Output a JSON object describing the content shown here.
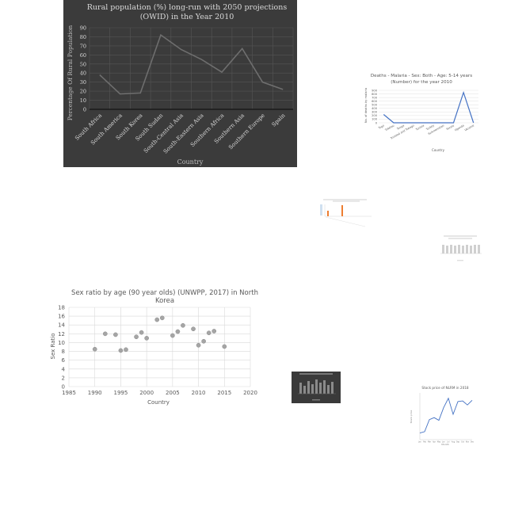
{
  "chart_data": [
    {
      "type": "line",
      "title": "Rural population (%) long-run with 2050 projections (OWID) in the Year 2010",
      "xlabel": "Country",
      "ylabel": "Percentage Of Rural Population",
      "categories": [
        "South Africa",
        "South America",
        "South Korea",
        "South Sudan",
        "South-Central Asia",
        "South-Eastern Asia",
        "Southern Africa",
        "Southern Asia",
        "Southern Europe",
        "Spain"
      ],
      "values": [
        38,
        17,
        18,
        82,
        66,
        55,
        41,
        67,
        30,
        22
      ],
      "ylim": [
        0,
        90
      ],
      "yticks": [
        "0",
        "10",
        "20",
        "30",
        "40",
        "50",
        "60",
        "70",
        "80",
        "90"
      ],
      "grid": true,
      "colors": {
        "background": "#3b3b3b",
        "line": "#6e6e6e",
        "text": "#d9d9d9",
        "grid": "#555555"
      }
    },
    {
      "type": "line",
      "title": "Deaths - Malaria - Sex: Both - Age: 5-14 years (Number) for the year 2010",
      "xlabel": "Country",
      "ylabel": "No. of deaths by malaria",
      "categories": [
        "Togo",
        "Tokelau",
        "Tonga",
        "Trinidad and Tobago",
        "Tunisia",
        "Turkey",
        "Turkmenistan",
        "Tuvalu",
        "Uganda",
        "Ukraine"
      ],
      "values": [
        230,
        0,
        0,
        0,
        0,
        0,
        0,
        0,
        840,
        0
      ],
      "ylim": [
        0,
        900
      ],
      "yticks": [
        "0",
        "100",
        "200",
        "300",
        "400",
        "500",
        "600",
        "700",
        "800",
        "900"
      ],
      "grid": true,
      "colors": {
        "line": "#4472c4",
        "grid": "#d9d9d9"
      }
    },
    {
      "type": "scatter",
      "title": "Sex ratio by age (90 year olds) (UNWPP, 2017) in North Korea",
      "xlabel": "Country",
      "ylabel": "Sex Ratio",
      "x": [
        1990,
        1992,
        1994,
        1995,
        1996,
        1998,
        1999,
        2000,
        2002,
        2003,
        2005,
        2006,
        2007,
        2009,
        2010,
        2011,
        2012,
        2013,
        2015
      ],
      "y": [
        8.5,
        12.0,
        11.8,
        8.2,
        8.4,
        11.3,
        12.3,
        11.0,
        15.2,
        15.6,
        11.6,
        12.5,
        13.9,
        13.1,
        9.4,
        10.3,
        12.2,
        12.6,
        9.1
      ],
      "xlim": [
        1985,
        2020
      ],
      "ylim": [
        0,
        18
      ],
      "xticks": [
        "1985",
        "1990",
        "1995",
        "2000",
        "2005",
        "2010",
        "2015",
        "2020"
      ],
      "yticks": [
        "0",
        "2",
        "4",
        "6",
        "8",
        "10",
        "12",
        "14",
        "16",
        "18"
      ],
      "grid": true,
      "colors": {
        "marker": "#a5a5a5",
        "grid": "#d9d9d9"
      }
    },
    {
      "type": "line",
      "title": "Stock price of NLRM in 2018",
      "xlabel": "Month",
      "ylabel": "Stock price",
      "categories": [
        "Jan",
        "Feb",
        "Mar",
        "Apr",
        "May",
        "Jun",
        "Jul",
        "Aug",
        "Sep",
        "Oct",
        "Nov",
        "Dec"
      ],
      "values": [
        10,
        12,
        30,
        33,
        29,
        48,
        62,
        38,
        57,
        58,
        52,
        59
      ],
      "ylim": [
        0,
        70
      ],
      "grid": true,
      "colors": {
        "line": "#4472c4"
      }
    }
  ]
}
